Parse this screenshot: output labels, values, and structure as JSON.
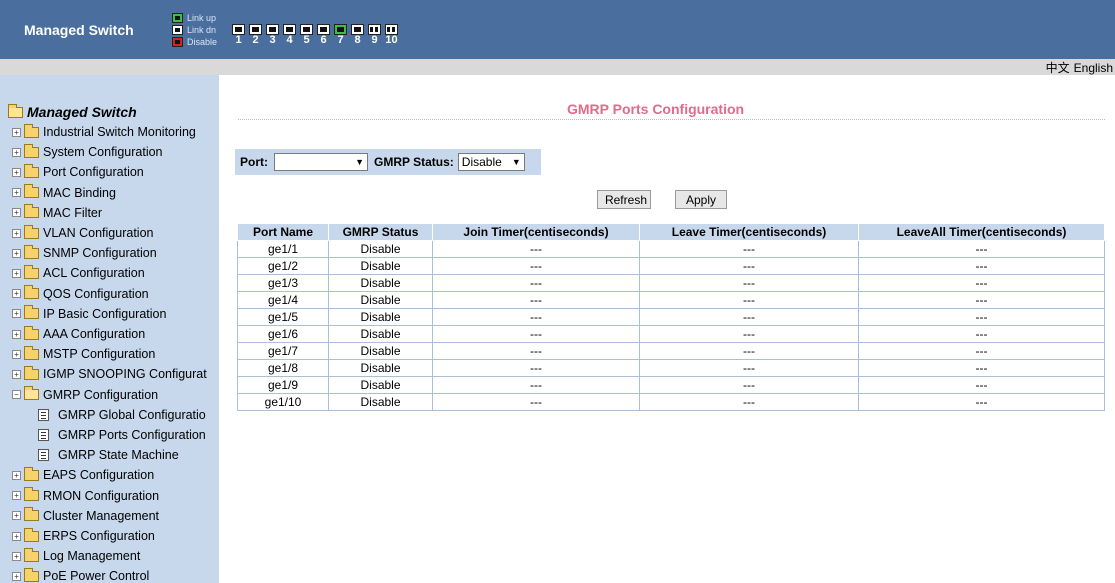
{
  "header": {
    "brand": "Managed Switch",
    "legend": [
      {
        "label": "Link up",
        "color": "#39c04a"
      },
      {
        "label": "Link dn",
        "color": "#ffffff"
      },
      {
        "label": "Disable",
        "color": "#d62020"
      }
    ],
    "ports": [
      {
        "num": "1",
        "state": "down"
      },
      {
        "num": "2",
        "state": "down"
      },
      {
        "num": "3",
        "state": "down"
      },
      {
        "num": "4",
        "state": "down"
      },
      {
        "num": "5",
        "state": "down"
      },
      {
        "num": "6",
        "state": "down"
      },
      {
        "num": "7",
        "state": "up"
      },
      {
        "num": "8",
        "state": "down"
      },
      {
        "num": "9",
        "state": "fiber"
      },
      {
        "num": "10",
        "state": "fiber"
      }
    ]
  },
  "lang": {
    "chinese": "中文",
    "english": "English"
  },
  "sidebar": {
    "root": "Managed Switch",
    "items": [
      {
        "label": "Industrial Switch Monitoring",
        "expanded": false
      },
      {
        "label": "System Configuration",
        "expanded": false
      },
      {
        "label": "Port Configuration",
        "expanded": false
      },
      {
        "label": "MAC Binding",
        "expanded": false
      },
      {
        "label": "MAC Filter",
        "expanded": false
      },
      {
        "label": "VLAN Configuration",
        "expanded": false
      },
      {
        "label": "SNMP Configuration",
        "expanded": false
      },
      {
        "label": "ACL Configuration",
        "expanded": false
      },
      {
        "label": "QOS Configuration",
        "expanded": false
      },
      {
        "label": "IP Basic Configuration",
        "expanded": false
      },
      {
        "label": "AAA Configuration",
        "expanded": false
      },
      {
        "label": "MSTP Configuration",
        "expanded": false
      },
      {
        "label": "IGMP SNOOPING Configurat",
        "expanded": false
      },
      {
        "label": "GMRP Configuration",
        "expanded": true
      },
      {
        "label": "EAPS Configuration",
        "expanded": false
      },
      {
        "label": "RMON Configuration",
        "expanded": false
      },
      {
        "label": "Cluster Management",
        "expanded": false
      },
      {
        "label": "ERPS Configuration",
        "expanded": false
      },
      {
        "label": "Log Management",
        "expanded": false
      },
      {
        "label": "PoE Power Control",
        "expanded": false
      }
    ],
    "gmrp_children": [
      {
        "label": "GMRP Global Configuratio"
      },
      {
        "label": "GMRP Ports Configuration"
      },
      {
        "label": "GMRP State Machine"
      }
    ]
  },
  "main": {
    "title": "GMRP Ports Configuration",
    "port_label": "Port:",
    "port_value": "",
    "status_label": "GMRP Status:",
    "status_value": "Disable",
    "refresh_label": "Refresh",
    "apply_label": "Apply",
    "columns": [
      "Port Name",
      "GMRP Status",
      "Join Timer(centiseconds)",
      "Leave Timer(centiseconds)",
      "LeaveAll Timer(centiseconds)"
    ],
    "rows": [
      [
        "ge1/1",
        "Disable",
        "---",
        "---",
        "---"
      ],
      [
        "ge1/2",
        "Disable",
        "---",
        "---",
        "---"
      ],
      [
        "ge1/3",
        "Disable",
        "---",
        "---",
        "---"
      ],
      [
        "ge1/4",
        "Disable",
        "---",
        "---",
        "---"
      ],
      [
        "ge1/5",
        "Disable",
        "---",
        "---",
        "---"
      ],
      [
        "ge1/6",
        "Disable",
        "---",
        "---",
        "---"
      ],
      [
        "ge1/7",
        "Disable",
        "---",
        "---",
        "---"
      ],
      [
        "ge1/8",
        "Disable",
        "---",
        "---",
        "---"
      ],
      [
        "ge1/9",
        "Disable",
        "---",
        "---",
        "---"
      ],
      [
        "ge1/10",
        "Disable",
        "---",
        "---",
        "---"
      ]
    ]
  }
}
